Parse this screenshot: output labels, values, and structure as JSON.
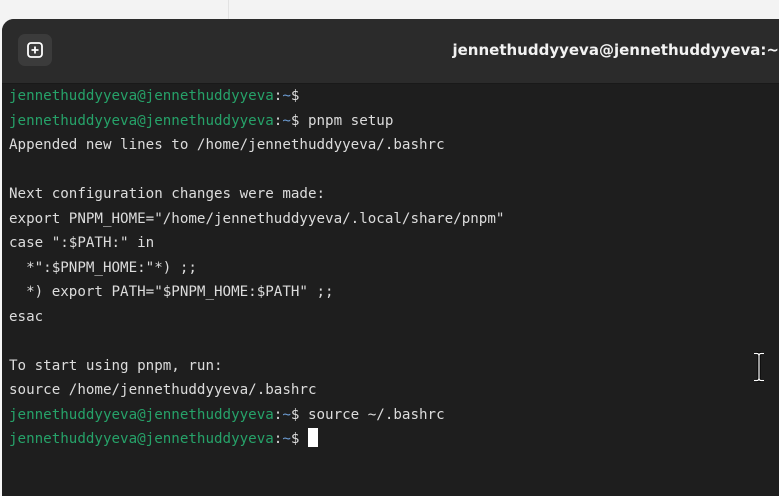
{
  "window": {
    "title": "jennethuddyyeva@jennethuddyyeva:~",
    "new_tab_icon": "plus-square-icon"
  },
  "terminal": {
    "prompt_user": "jennethuddyyeva@jennethuddyyeva",
    "prompt_sep": ":",
    "prompt_path": "~",
    "prompt_symbol": "$",
    "lines": [
      {
        "type": "prompt",
        "cmd": ""
      },
      {
        "type": "prompt",
        "cmd": "pnpm setup"
      },
      {
        "type": "out",
        "text": "Appended new lines to /home/jennethuddyyeva/.bashrc"
      },
      {
        "type": "out",
        "text": ""
      },
      {
        "type": "out",
        "text": "Next configuration changes were made:"
      },
      {
        "type": "out",
        "text": "export PNPM_HOME=\"/home/jennethuddyyeva/.local/share/pnpm\""
      },
      {
        "type": "out",
        "text": "case \":$PATH:\" in"
      },
      {
        "type": "out",
        "text": "  *\":$PNPM_HOME:\"*) ;;"
      },
      {
        "type": "out",
        "text": "  *) export PATH=\"$PNPM_HOME:$PATH\" ;;"
      },
      {
        "type": "out",
        "text": "esac"
      },
      {
        "type": "out",
        "text": ""
      },
      {
        "type": "out",
        "text": "To start using pnpm, run:"
      },
      {
        "type": "out",
        "text": "source /home/jennethuddyyeva/.bashrc"
      },
      {
        "type": "prompt",
        "cmd": "source ~/.bashrc"
      },
      {
        "type": "prompt",
        "cmd": "",
        "cursor": true
      }
    ]
  },
  "colors": {
    "background": "#1e1e1e",
    "titlebar": "#2b2b2b",
    "prompt_user": "#26a269",
    "prompt_path": "#6c9bd1",
    "text": "#dcdcdc"
  }
}
